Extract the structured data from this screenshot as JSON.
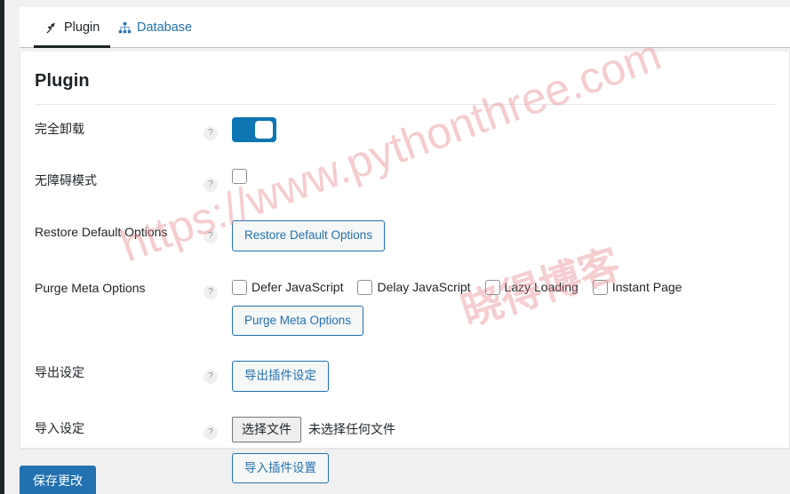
{
  "tabs": [
    {
      "id": "plugin",
      "label": "Plugin",
      "icon": "plug-icon",
      "active": true
    },
    {
      "id": "database",
      "label": "Database",
      "icon": "sitemap-icon",
      "active": false
    }
  ],
  "card": {
    "title": "Plugin"
  },
  "help_marker": "?",
  "rows": {
    "uninstall": {
      "label": "完全卸载",
      "toggle_state": "on"
    },
    "accessibility": {
      "label": "无障碍模式",
      "checked": false
    },
    "restore_defaults": {
      "label": "Restore Default Options",
      "button": "Restore Default Options"
    },
    "purge_meta": {
      "label": "Purge Meta Options",
      "button": "Purge Meta Options",
      "options": [
        {
          "label": "Defer JavaScript",
          "checked": false
        },
        {
          "label": "Delay JavaScript",
          "checked": false
        },
        {
          "label": "Lazy Loading",
          "checked": false
        },
        {
          "label": "Instant Page",
          "checked": false
        }
      ]
    },
    "export": {
      "label": "导出设定",
      "button": "导出插件设定"
    },
    "import": {
      "label": "导入设定",
      "file_button": "选择文件",
      "file_status": "未选择任何文件",
      "button": "导入插件设置"
    }
  },
  "footer": {
    "save_label": "保存更改"
  },
  "watermark": {
    "url_text": "https://www.pythonthree.com",
    "brand_text": "晓得博客",
    "color": "#e8878b"
  },
  "colors": {
    "accent_blue": "#2271b1",
    "toggle_on": "#0d76b3",
    "page_bg": "#f0f0f1",
    "card_bg": "#ffffff",
    "text": "#1d2327",
    "sidebar_dark": "#1d2327"
  }
}
